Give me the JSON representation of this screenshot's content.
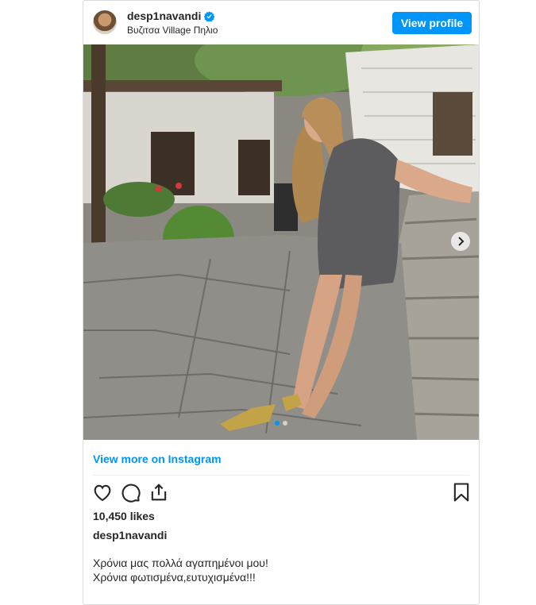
{
  "post": {
    "username": "desp1navandi",
    "location": "Βυζιτσα Village Πηλιο",
    "view_profile_label": "View profile",
    "view_more_label": "View more on Instagram",
    "likes": "10,450 likes",
    "caption_author": "desp1navandi",
    "caption_lines": [
      "Χρόνια μας πολλά αγαπημένοι μου!",
      "Χρόνια φωτισμένα,ευτυχισμένα!!!"
    ],
    "carousel": {
      "total_slides": 2,
      "active_slide": 1
    }
  },
  "icons": {
    "verified": "verified-badge-icon",
    "like": "heart-icon",
    "comment": "comment-icon",
    "share": "share-icon",
    "save": "bookmark-icon",
    "next": "chevron-right-icon"
  },
  "colors": {
    "accent": "#0095f6",
    "text": "#262626",
    "border": "#dbdbdb"
  }
}
